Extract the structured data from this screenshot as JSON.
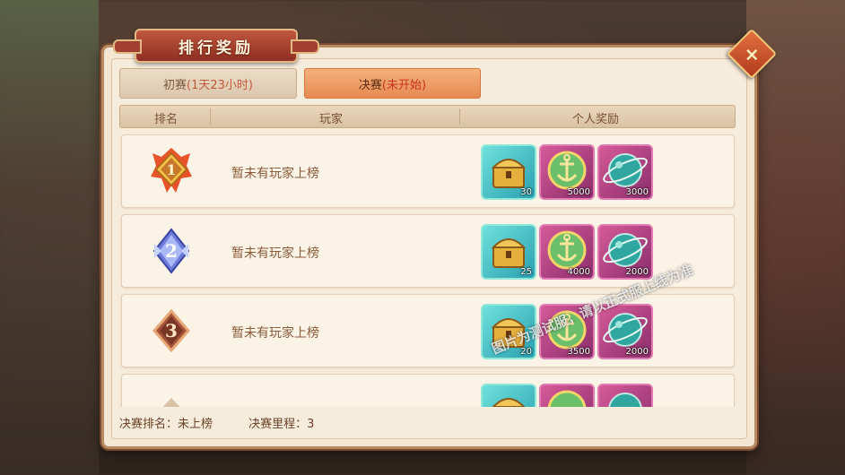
{
  "dialog": {
    "title": "排行奖励",
    "close_label": "×"
  },
  "tabs": [
    {
      "label": "初赛",
      "status": "(1天23小时)",
      "active": false
    },
    {
      "label": "决赛",
      "status": "(未开始)",
      "active": true
    }
  ],
  "table": {
    "headers": [
      "排名",
      "玩家",
      "个人奖励"
    ],
    "rows": [
      {
        "rank": "1",
        "player": "暂未有玩家上榜",
        "rewards": [
          {
            "item": "treasure-chest-icon",
            "count": "30"
          },
          {
            "item": "anchor-coin-icon",
            "count": "5000"
          },
          {
            "item": "planet-orb-icon",
            "count": "3000"
          }
        ]
      },
      {
        "rank": "2",
        "player": "暂未有玩家上榜",
        "rewards": [
          {
            "item": "treasure-chest-icon",
            "count": "25"
          },
          {
            "item": "anchor-coin-icon",
            "count": "4000"
          },
          {
            "item": "planet-orb-icon",
            "count": "2000"
          }
        ]
      },
      {
        "rank": "3",
        "player": "暂未有玩家上榜",
        "rewards": [
          {
            "item": "treasure-chest-icon",
            "count": "20"
          },
          {
            "item": "anchor-coin-icon",
            "count": "3500"
          },
          {
            "item": "planet-orb-icon",
            "count": "2000"
          }
        ]
      }
    ]
  },
  "footer": {
    "final_rank": "决赛排名：未上榜",
    "final_mileage": "决赛里程：3"
  },
  "watermark": "图片为测试服，请以正式服上线为准",
  "colors": {
    "panel": "#f3e6d3",
    "ribbon": "#b13b28",
    "active_tab": "#ef9e66",
    "text_brown": "#8a5a38"
  }
}
